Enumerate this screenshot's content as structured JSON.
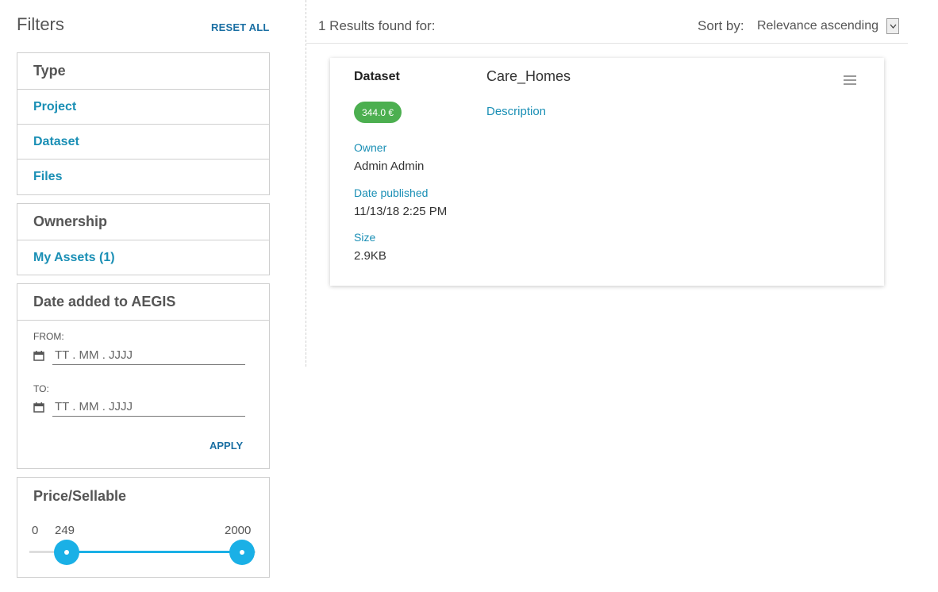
{
  "sidebar": {
    "title": "Filters",
    "reset_label": "RESET ALL",
    "type_panel": {
      "heading": "Type",
      "items": [
        "Project",
        "Dataset",
        "Files"
      ]
    },
    "ownership_panel": {
      "heading": "Ownership",
      "items": [
        "My Assets (1)"
      ]
    },
    "date_panel": {
      "heading": "Date added to AEGIS",
      "from_label": "FROM:",
      "to_label": "TO:",
      "from_placeholder": "TT . MM . JJJJ",
      "to_placeholder": "TT . MM . JJJJ",
      "apply_label": "APPLY"
    },
    "price_panel": {
      "heading": "Price/Sellable",
      "min_label": "0",
      "low_value": "249",
      "high_value": "2000"
    }
  },
  "results": {
    "count_text": "1 Results found for:",
    "sort_label": "Sort by:",
    "sort_value": "Relevance ascending",
    "cards": [
      {
        "type": "Dataset",
        "title": "Care_Homes",
        "price": "344.0 €",
        "description_link": "Description",
        "owner_label": "Owner",
        "owner_value": "Admin Admin",
        "date_label": "Date published",
        "date_value": "11/13/18 2:25 PM",
        "size_label": "Size",
        "size_value": "2.9KB"
      }
    ]
  },
  "colors": {
    "accent_link": "#1a8fb5",
    "reset_apply": "#1a6fa3",
    "slider": "#1ab0e6",
    "price_badge": "#4caf50"
  },
  "icons": {
    "calendar": "calendar-icon",
    "menu": "hamburger-menu-icon",
    "dropdown": "chevron-down-icon"
  }
}
